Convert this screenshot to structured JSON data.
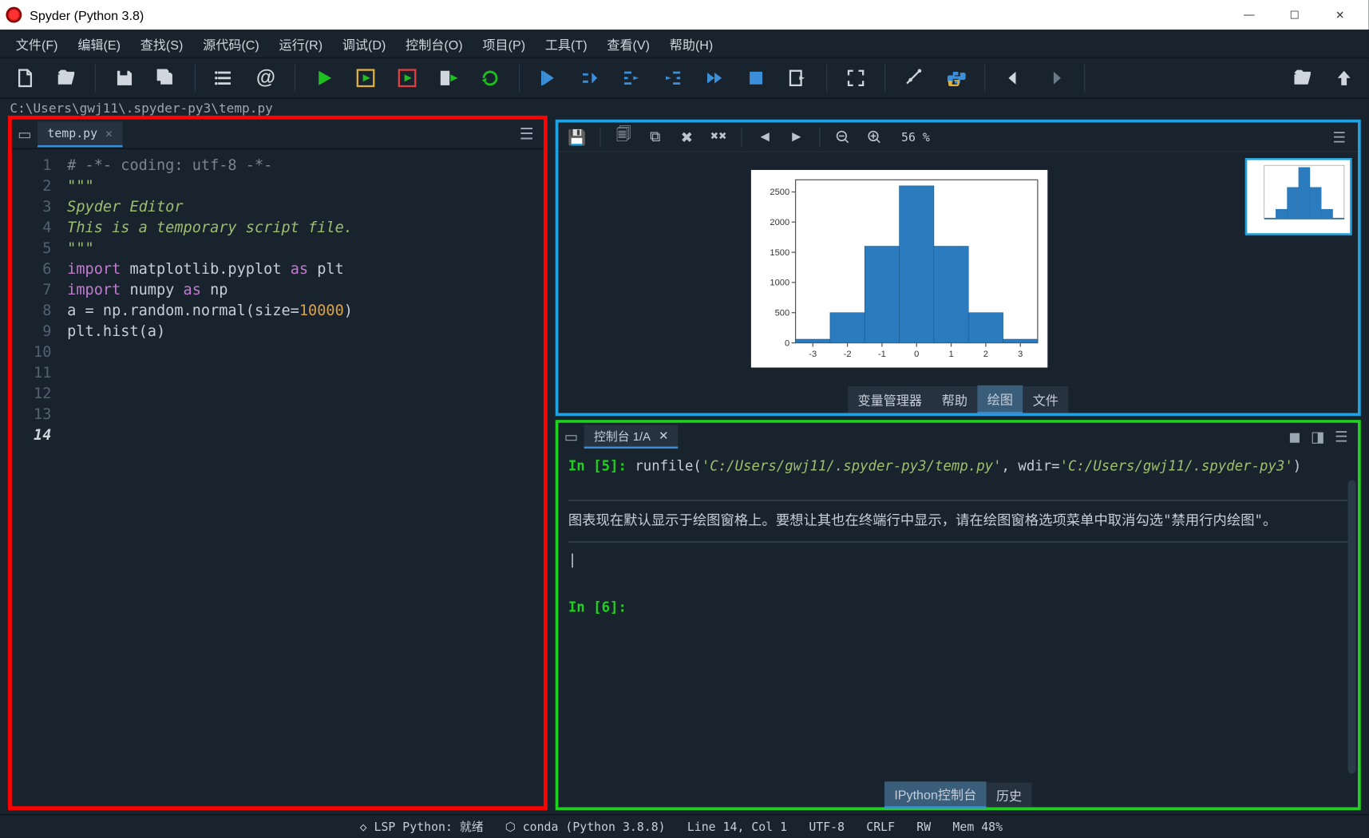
{
  "window": {
    "title": "Spyder (Python 3.8)"
  },
  "menu": {
    "file": "文件(F)",
    "edit": "编辑(E)",
    "search": "查找(S)",
    "source": "源代码(C)",
    "run": "运行(R)",
    "debug": "调试(D)",
    "consoles": "控制台(O)",
    "projects": "项目(P)",
    "tools": "工具(T)",
    "view": "查看(V)",
    "help": "帮助(H)"
  },
  "path": "C:\\Users\\gwj11\\.spyder-py3\\temp.py",
  "editor": {
    "filename": "temp.py",
    "lines": [
      {
        "n": 1,
        "seg": [
          [
            "cmt",
            "# -*- coding: utf-8 -*-"
          ]
        ]
      },
      {
        "n": 2,
        "seg": [
          [
            "str",
            "\"\"\""
          ]
        ]
      },
      {
        "n": 3,
        "seg": [
          [
            "str",
            "Spyder Editor"
          ]
        ]
      },
      {
        "n": 4,
        "seg": [
          [
            "str",
            ""
          ]
        ]
      },
      {
        "n": 5,
        "seg": [
          [
            "str",
            "This is a temporary script file."
          ]
        ]
      },
      {
        "n": 6,
        "seg": [
          [
            "str",
            "\"\"\""
          ]
        ]
      },
      {
        "n": 7,
        "seg": [
          [
            "id",
            ""
          ]
        ]
      },
      {
        "n": 8,
        "seg": [
          [
            "kw",
            "import "
          ],
          [
            "id",
            "matplotlib.pyplot "
          ],
          [
            "kw",
            "as "
          ],
          [
            "id",
            "plt"
          ]
        ]
      },
      {
        "n": 9,
        "seg": [
          [
            "kw",
            "import "
          ],
          [
            "id",
            "numpy "
          ],
          [
            "kw",
            "as "
          ],
          [
            "id",
            "np"
          ]
        ]
      },
      {
        "n": 10,
        "seg": [
          [
            "id",
            ""
          ]
        ]
      },
      {
        "n": 11,
        "seg": [
          [
            "id",
            "a = np.random.normal(size="
          ],
          [
            "num",
            "10000"
          ],
          [
            "id",
            ")"
          ]
        ]
      },
      {
        "n": 12,
        "seg": [
          [
            "id",
            "plt.hist(a)"
          ]
        ]
      },
      {
        "n": 13,
        "seg": [
          [
            "id",
            ""
          ]
        ]
      },
      {
        "n": 14,
        "seg": [
          [
            "id",
            ""
          ]
        ],
        "current": true
      }
    ]
  },
  "plot": {
    "zoom": "56 %",
    "tabs": {
      "var": "变量管理器",
      "help": "帮助",
      "plots": "绘图",
      "files": "文件",
      "active": "plots"
    }
  },
  "chart_data": {
    "type": "bar",
    "categories": [
      "-3",
      "-2",
      "-1",
      "0",
      "1",
      "2",
      "3"
    ],
    "values": [
      60,
      500,
      1600,
      2600,
      1600,
      500,
      60
    ],
    "xticks": [
      "-3",
      "-2",
      "-1",
      "0",
      "1",
      "2",
      "3"
    ],
    "yticks": [
      0,
      500,
      1000,
      1500,
      2000,
      2500
    ],
    "ylim": [
      0,
      2700
    ],
    "title": "",
    "xlabel": "",
    "ylabel": ""
  },
  "console": {
    "tab": "控制台 1/A",
    "in5_label": "In [5]:",
    "in5_fn": "runfile",
    "in5_arg1": "'C:/Users/gwj11/.spyder-py3/temp.py'",
    "in5_kw": ", wdir=",
    "in5_arg2": "'C:/Users/gwj11/.spyder-py3'",
    "in5_close": ")",
    "info": "图表现在默认显示于绘图窗格上。要想让其也在终端行中显示，请在绘图窗格选项菜单中取消勾选\"禁用行内绘图\"。",
    "in6_label": "In [6]:",
    "bottom_tabs": {
      "ipy": "IPython控制台",
      "hist": "历史",
      "active": "ipy"
    }
  },
  "status": {
    "lsp": "LSP Python: 就绪",
    "env": "conda (Python 3.8.8)",
    "pos": "Line 14, Col 1",
    "enc": "UTF-8",
    "eol": "CRLF",
    "rw": "RW",
    "mem": "Mem 48%"
  }
}
